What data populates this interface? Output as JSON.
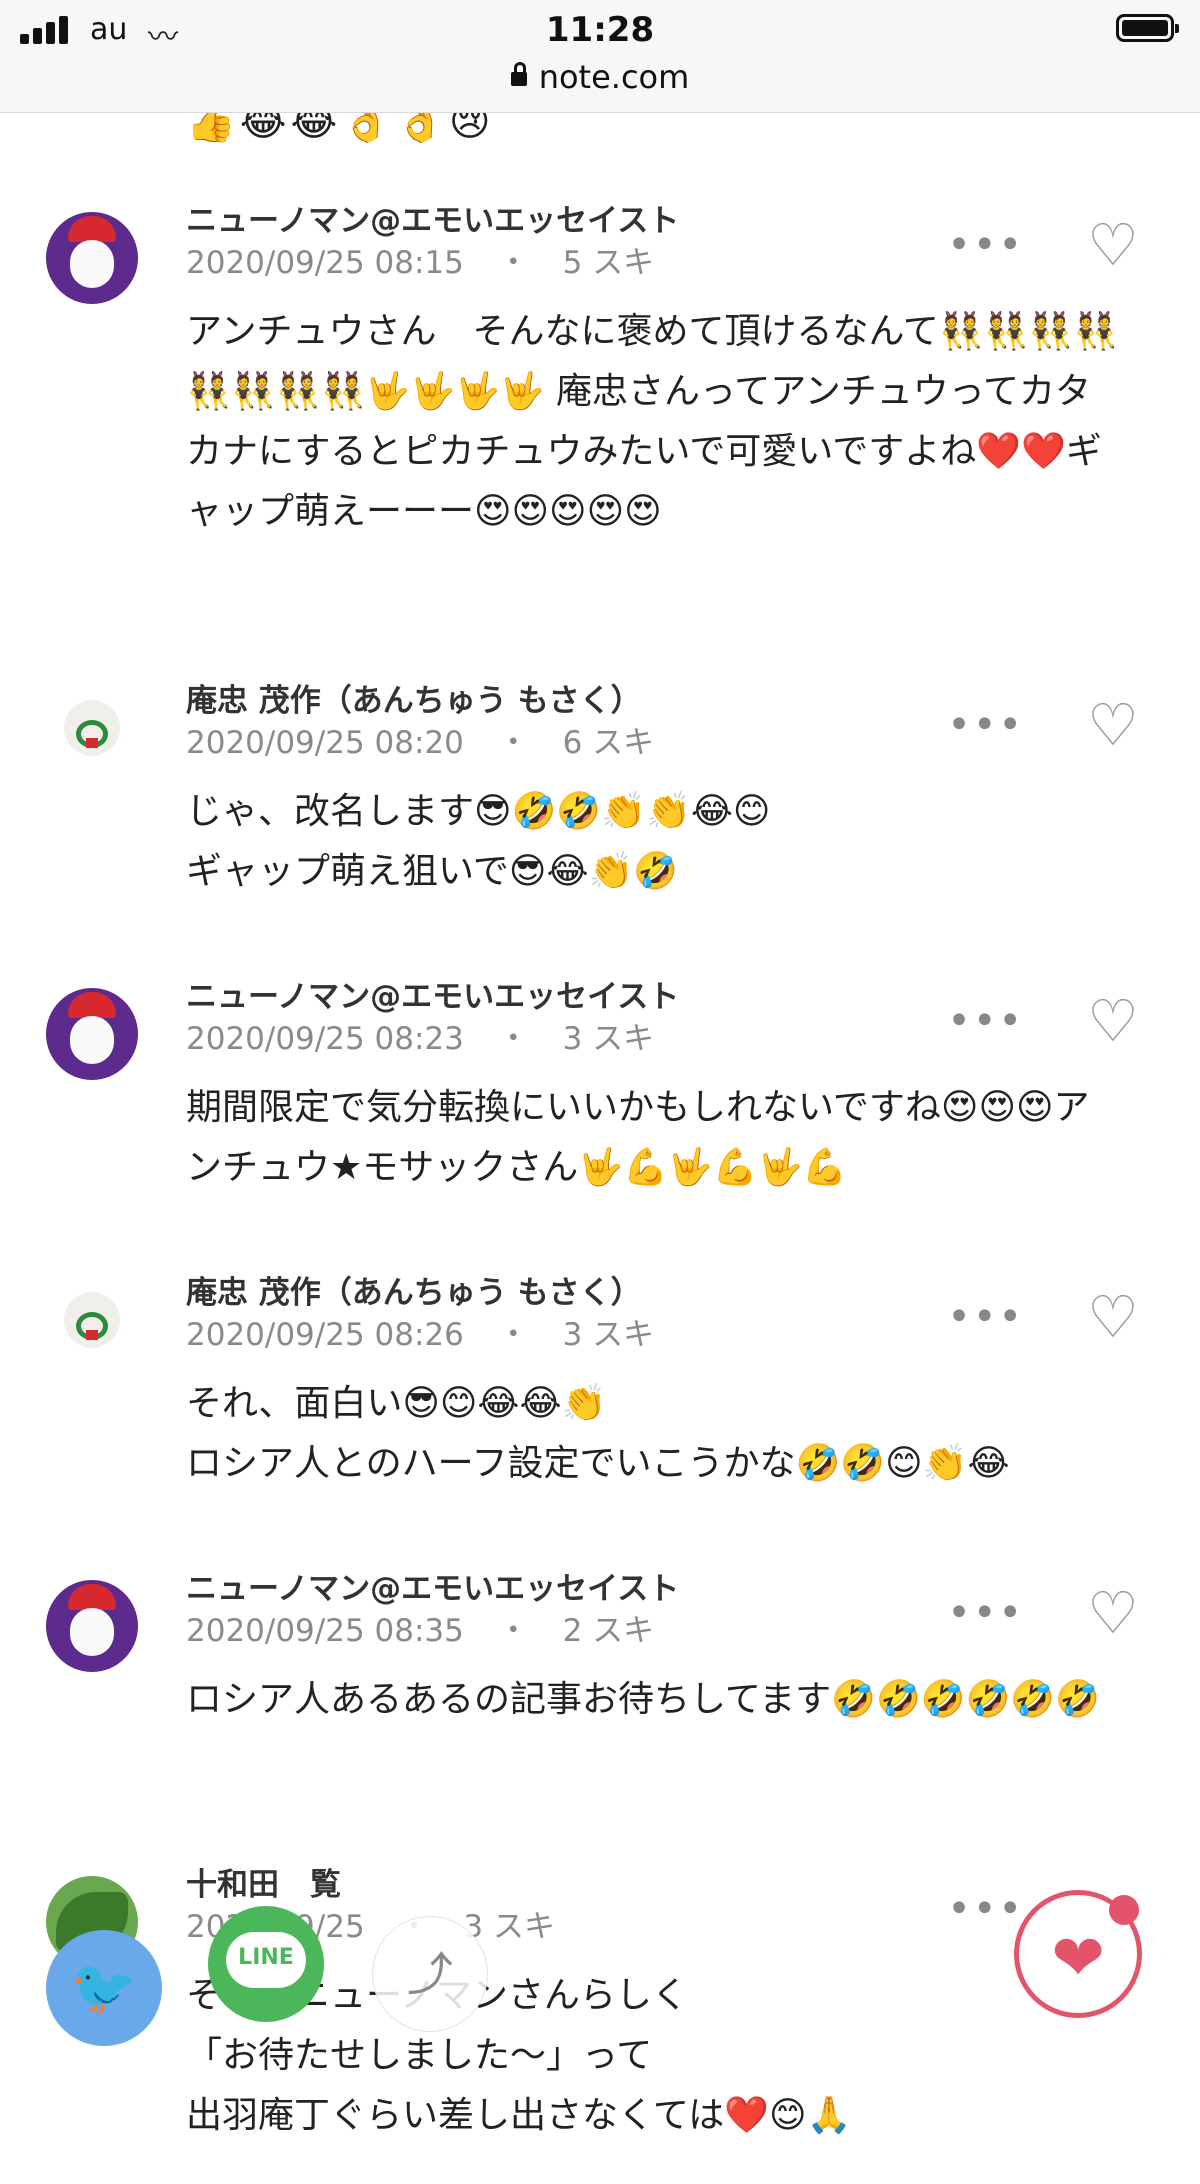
{
  "status_bar": {
    "carrier": "au",
    "time": "11:28",
    "url": "note.com"
  },
  "top_emoji": "👍😂😂👌👌😢",
  "comments": [
    {
      "author": "ニューノマン@エモいエッセイスト",
      "date": "2020/09/25 08:15",
      "separator": "・",
      "likes": "5 スキ",
      "body": "アンチュウさん　そんなに褒めて頂けるなんて👯👯👯👯👯👯👯👯🤟🤟🤟🤟 庵忠さんってアンチュウってカタカナにするとピカチュウみたいで可愛いですよね❤️❤️ギャップ萌えーーー😍😍😍😍😍"
    },
    {
      "author": "庵忠 茂作（あんちゅう もさく）",
      "date": "2020/09/25 08:20",
      "separator": "・",
      "likes": "6 スキ",
      "body_line1": "じゃ、改名します😎🤣🤣👏👏😂😊",
      "body_line2": "ギャップ萌え狙いで😎😂👏🤣"
    },
    {
      "author": "ニューノマン@エモいエッセイスト",
      "date": "2020/09/25 08:23",
      "separator": "・",
      "likes": "3 スキ",
      "body": "期間限定で気分転換にいいかもしれないですね😍😍😍アンチュウ★モサックさん🤟💪🤟💪🤟💪"
    },
    {
      "author": "庵忠 茂作（あんちゅう もさく）",
      "date": "2020/09/25 08:26",
      "separator": "・",
      "likes": "3 スキ",
      "body_line1": "それ、面白い😎😊😂😂👏",
      "body_line2": "ロシア人とのハーフ設定でいこうかな🤣🤣😊👏😂"
    },
    {
      "author": "ニューノマン@エモいエッセイスト",
      "date": "2020/09/25 08:35",
      "separator": "・",
      "likes": "2 スキ",
      "body": "ロシア人あるあるの記事お待ちしてます🤣🤣🤣🤣🤣🤣"
    },
    {
      "author": "十和田　覧",
      "date": "2020/09/25",
      "separator": "・",
      "likes": "3 スキ",
      "body_line1": "それはニューノマンさんらしく",
      "body_line2": "「お待たせしました〜」って",
      "body_line3": "出羽庵丁ぐらい差し出さなくては❤️😊🙏"
    }
  ],
  "icons": {
    "dots": "•••",
    "heart": "♡",
    "twitter": "🐦",
    "line": "LINE",
    "share": "⤴",
    "like_filled": "❤"
  },
  "colors": {
    "twitter": "#6aa9e9",
    "line": "#4cb65a",
    "like": "#e3546b"
  }
}
